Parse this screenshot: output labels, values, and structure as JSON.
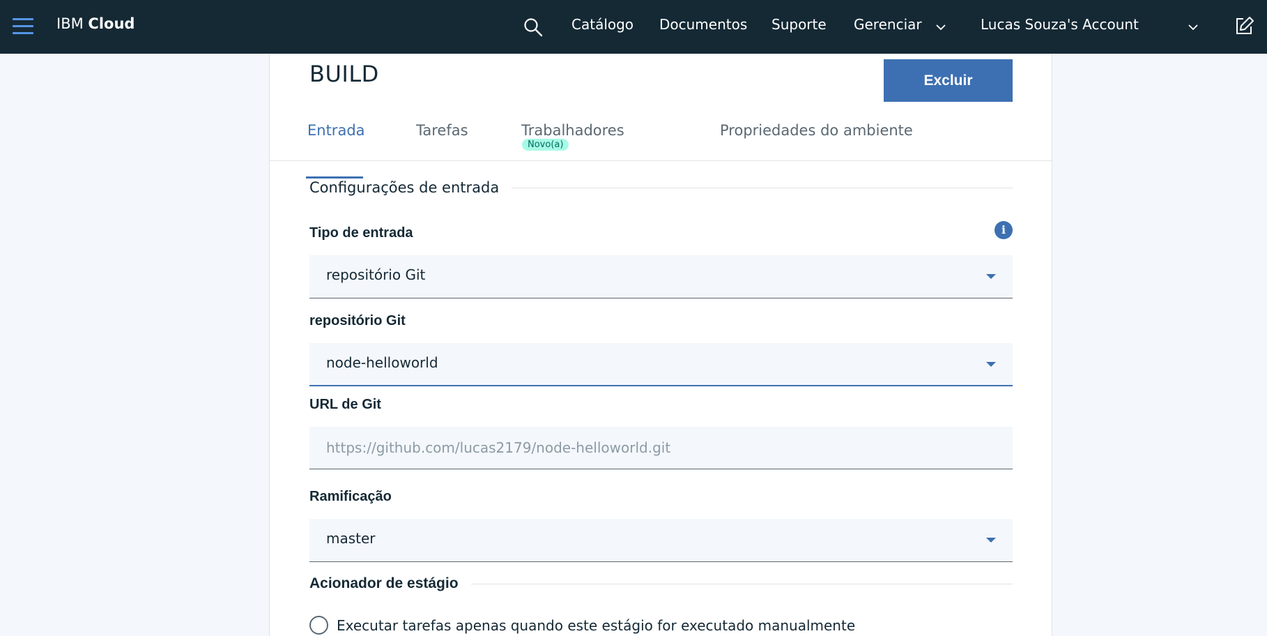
{
  "header": {
    "brand_prefix": "IBM",
    "brand_suffix": "Cloud",
    "nav": {
      "catalog": "Catálogo",
      "docs": "Documentos",
      "support": "Suporte",
      "manage": "Gerenciar",
      "account": "Lucas Souza's Account"
    }
  },
  "stage": {
    "title": "BUILD",
    "delete_label": "Excluir"
  },
  "tabs": [
    {
      "label": "Entrada",
      "active": true
    },
    {
      "label": "Tarefas",
      "active": false
    },
    {
      "label": "Trabalhadores",
      "active": false,
      "badge": "Novo(a)"
    },
    {
      "label": "Propriedades do ambiente",
      "active": false
    }
  ],
  "form": {
    "section_title": "Configurações de entrada",
    "input_type": {
      "label": "Tipo de entrada",
      "value": "repositório Git"
    },
    "git_repo": {
      "label": "repositório Git",
      "value": "node-helloworld"
    },
    "git_url": {
      "label": "URL de Git",
      "placeholder": "https://github.com/lucas2179/node-helloworld.git"
    },
    "branch": {
      "label": "Ramificação",
      "value": "master"
    },
    "trigger": {
      "section_title": "Acionador de estágio",
      "manual_option": "Executar tarefas apenas quando este estágio for executado manualmente"
    }
  },
  "colors": {
    "nav_bg": "#152935",
    "accent": "#3d70b2",
    "page_bg": "#f4f7fb",
    "badge_bg": "#a7fae6"
  }
}
